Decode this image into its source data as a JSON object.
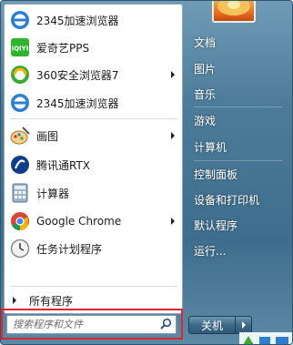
{
  "programs": [
    {
      "label": "2345加速浏览器",
      "icon": "2345-browser-icon",
      "submenu": false
    },
    {
      "label": "爱奇艺PPS",
      "icon": "iqiyi-icon",
      "submenu": false
    },
    {
      "label": "360安全浏览器7",
      "icon": "360-browser-icon",
      "submenu": true
    },
    {
      "label": "2345加速浏览器",
      "icon": "2345-browser-icon",
      "submenu": false
    },
    {
      "label": "画图",
      "icon": "paint-icon",
      "submenu": true
    },
    {
      "label": "腾讯通RTX",
      "icon": "rtx-icon",
      "submenu": false
    },
    {
      "label": "计算器",
      "icon": "calculator-icon",
      "submenu": false
    },
    {
      "label": "Google Chrome",
      "icon": "chrome-icon",
      "submenu": true
    },
    {
      "label": "任务计划程序",
      "icon": "task-scheduler-icon",
      "submenu": false
    }
  ],
  "all_programs_label": "所有程序",
  "search": {
    "placeholder": "搜索程序和文件",
    "value": ""
  },
  "right_items": [
    {
      "label": "文档",
      "submenu": false
    },
    {
      "label": "图片",
      "submenu": false
    },
    {
      "label": "音乐",
      "submenu": false
    },
    {
      "label": "游戏",
      "submenu": false
    },
    {
      "label": "计算机",
      "submenu": false
    },
    {
      "label": "控制面板",
      "submenu": false
    },
    {
      "label": "设备和打印机",
      "submenu": false
    },
    {
      "label": "默认程序",
      "submenu": false
    },
    {
      "label": "运行...",
      "submenu": false
    }
  ],
  "shutdown_label": "关机",
  "colors": {
    "highlight_border": "#e0262b",
    "menu_blue": "#4d7c9a"
  }
}
